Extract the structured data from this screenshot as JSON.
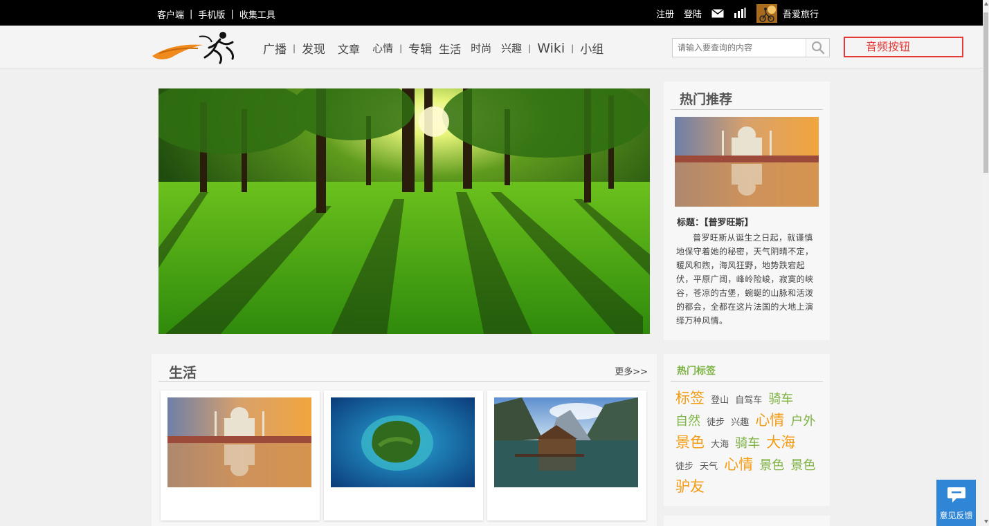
{
  "topbar": {
    "left_links": [
      "客户端",
      "手机版",
      "收集工具"
    ],
    "separator": "|",
    "register": "注册",
    "login": "登陆",
    "username": "吾爱旅行",
    "icons": [
      "mail-icon",
      "speaker-icon",
      "avatar"
    ]
  },
  "nav": {
    "items": [
      "广播",
      "发现",
      "文章",
      "心情",
      "专辑",
      "生活",
      "时尚",
      "兴趣",
      "Wiki",
      "小组"
    ],
    "separator": "|"
  },
  "search": {
    "placeholder": "请输入要查询的内容",
    "icon": "search-icon"
  },
  "audio_button": {
    "label": "音频按钮"
  },
  "hot": {
    "title": "热门推荐",
    "caption": "标题：【普罗旺斯】",
    "description": "普罗旺斯从诞生之日起，就谨慎地保守着她的秘密，天气阴晴不定，暖风和煦，海风狂野，地势跌宕起伏，平原广阔，峰岭险峻，寂寞的峡谷，苍凉的古堡，蜿蜒的山脉和活泼的都会，全都在这片法国的大地上演绎万种风情。"
  },
  "life": {
    "title": "生活",
    "more": "更多>>"
  },
  "tags": {
    "title": "热门标签",
    "items": [
      {
        "text": "标签",
        "size": "lg",
        "color": "orange"
      },
      {
        "text": "登山",
        "size": "sm",
        "color": "dark"
      },
      {
        "text": "自驾车",
        "size": "sm",
        "color": "dark"
      },
      {
        "text": "骑车",
        "size": "md",
        "color": "green"
      },
      {
        "text": "自然",
        "size": "md",
        "color": "green"
      },
      {
        "text": "徒步",
        "size": "sm",
        "color": "dark"
      },
      {
        "text": "兴趣",
        "size": "sm",
        "color": "dark"
      },
      {
        "text": "心情",
        "size": "lg",
        "color": "orange"
      },
      {
        "text": "户外",
        "size": "md",
        "color": "green"
      },
      {
        "text": "景色",
        "size": "lg",
        "color": "orange"
      },
      {
        "text": "大海",
        "size": "sm",
        "color": "dark"
      },
      {
        "text": "骑车",
        "size": "md",
        "color": "green"
      },
      {
        "text": "大海",
        "size": "lg",
        "color": "orange"
      },
      {
        "text": "徒步",
        "size": "sm",
        "color": "dark"
      },
      {
        "text": "天气",
        "size": "sm",
        "color": "dark"
      },
      {
        "text": "心情",
        "size": "lg",
        "color": "orange"
      },
      {
        "text": "景色",
        "size": "md",
        "color": "green"
      },
      {
        "text": "景色",
        "size": "md",
        "color": "green"
      },
      {
        "text": "驴友",
        "size": "lg",
        "color": "orange"
      }
    ]
  },
  "feedback": {
    "label": "意见反馈",
    "icon": "chat-bubble-icon"
  },
  "colors": {
    "topbar_bg": "#000000",
    "accent_red": "#e53935",
    "tag_orange": "#f39c12",
    "tag_green": "#7cb342",
    "feedback_blue": "#2f86d6"
  }
}
